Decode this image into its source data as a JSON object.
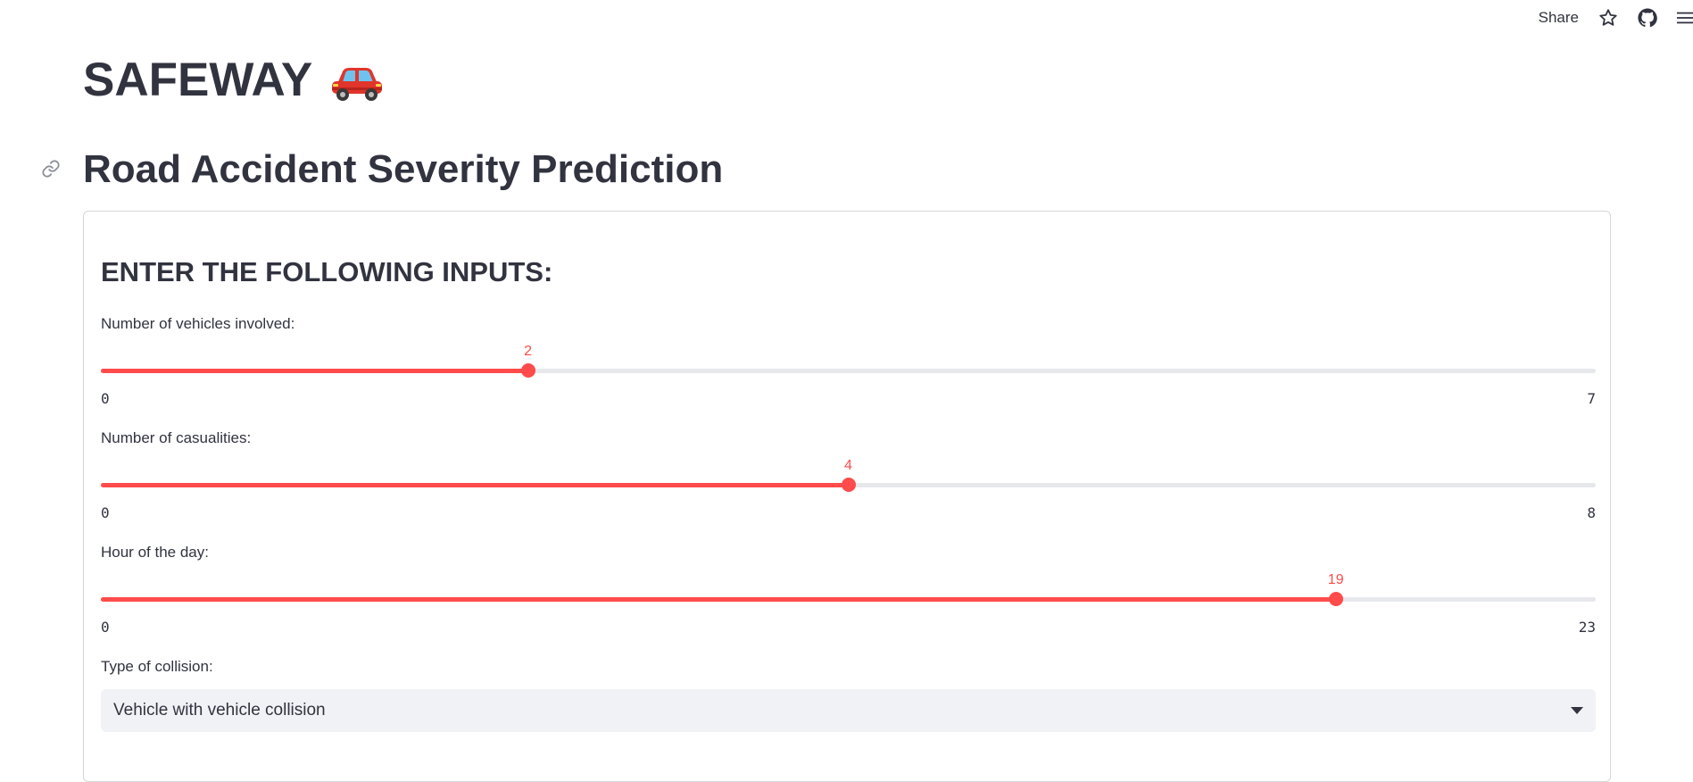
{
  "header": {
    "share_label": "Share",
    "icons": [
      "star-icon",
      "github-icon",
      "hamburger-menu-icon"
    ]
  },
  "app": {
    "title": "SAFEWAY",
    "title_emoji": "car-icon",
    "subtitle": "Road Accident Severity Prediction"
  },
  "form": {
    "heading": "ENTER THE FOLLOWING INPUTS:",
    "sliders": [
      {
        "label": "Number of vehicles involved:",
        "value": "2",
        "min": "0",
        "max": "7"
      },
      {
        "label": "Number of casualities:",
        "value": "4",
        "min": "0",
        "max": "8"
      },
      {
        "label": "Hour of the day:",
        "value": "19",
        "min": "0",
        "max": "23"
      }
    ],
    "collision": {
      "label": "Type of collision:",
      "selected": "Vehicle with vehicle collision"
    }
  },
  "colors": {
    "accent": "#ff4b4b",
    "track": "#e6e8ec",
    "text": "#31333f",
    "select_bg": "#f0f2f6"
  }
}
